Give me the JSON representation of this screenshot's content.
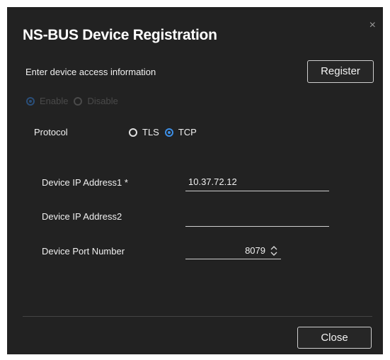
{
  "dialog": {
    "title": "NS-BUS Device Registration",
    "close_glyph": "×",
    "subtitle": "Enter device access information",
    "register_label": "Register",
    "close_label": "Close"
  },
  "mode": {
    "options": [
      {
        "label": "Enable",
        "selected": true
      },
      {
        "label": "Disable",
        "selected": false
      }
    ],
    "disabled": true
  },
  "protocol": {
    "label": "Protocol",
    "options": [
      {
        "label": "TLS",
        "selected": false
      },
      {
        "label": "TCP",
        "selected": true
      }
    ]
  },
  "fields": {
    "ip1": {
      "label": "Device IP Address1 *",
      "value": "10.37.72.12"
    },
    "ip2": {
      "label": "Device IP Address2",
      "value": ""
    },
    "port": {
      "label": "Device Port Number",
      "value": "8079"
    }
  },
  "colors": {
    "background": "#222222",
    "accent": "#3d8fe6",
    "disabled_text": "#4a4a4a"
  },
  "icons": {
    "spinner": "updown-chevron-icon",
    "close": "close-icon"
  }
}
